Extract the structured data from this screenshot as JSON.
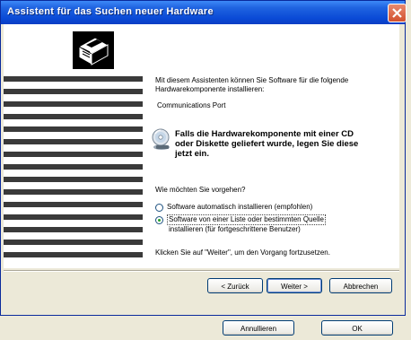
{
  "window": {
    "title": "Assistent für das Suchen neuer Hardware"
  },
  "content": {
    "intro_line1": "Mit diesem Assistenten können Sie Software für die folgende",
    "intro_line2": "Hardwarekomponente installieren:",
    "device_name": "Communications Port",
    "warning_line1": "Falls die Hardwarekomponente mit einer CD",
    "warning_line2": "oder Diskette geliefert wurde, legen Sie diese",
    "warning_line3": "jetzt ein.",
    "question": "Wie möchten Sie vorgehen?",
    "option_auto": "Software automatisch installieren (empfohlen)",
    "option_manual_line1": "Software von einer Liste oder bestimmten Quelle",
    "option_manual_line2": "installieren (für fortgeschrittene Benutzer)",
    "selected_option": "manual",
    "hint": "Klicken Sie auf \"Weiter\", um den Vorgang fortzusetzen."
  },
  "buttons": {
    "back": "< Zurück",
    "next": "Weiter >",
    "cancel": "Abbrechen"
  },
  "outer_buttons": {
    "cancel": "Annullieren",
    "ok": "OK"
  },
  "icons": {
    "close": "close-icon",
    "logo": "hardware-wizard-icon",
    "cd": "cd-icon"
  }
}
